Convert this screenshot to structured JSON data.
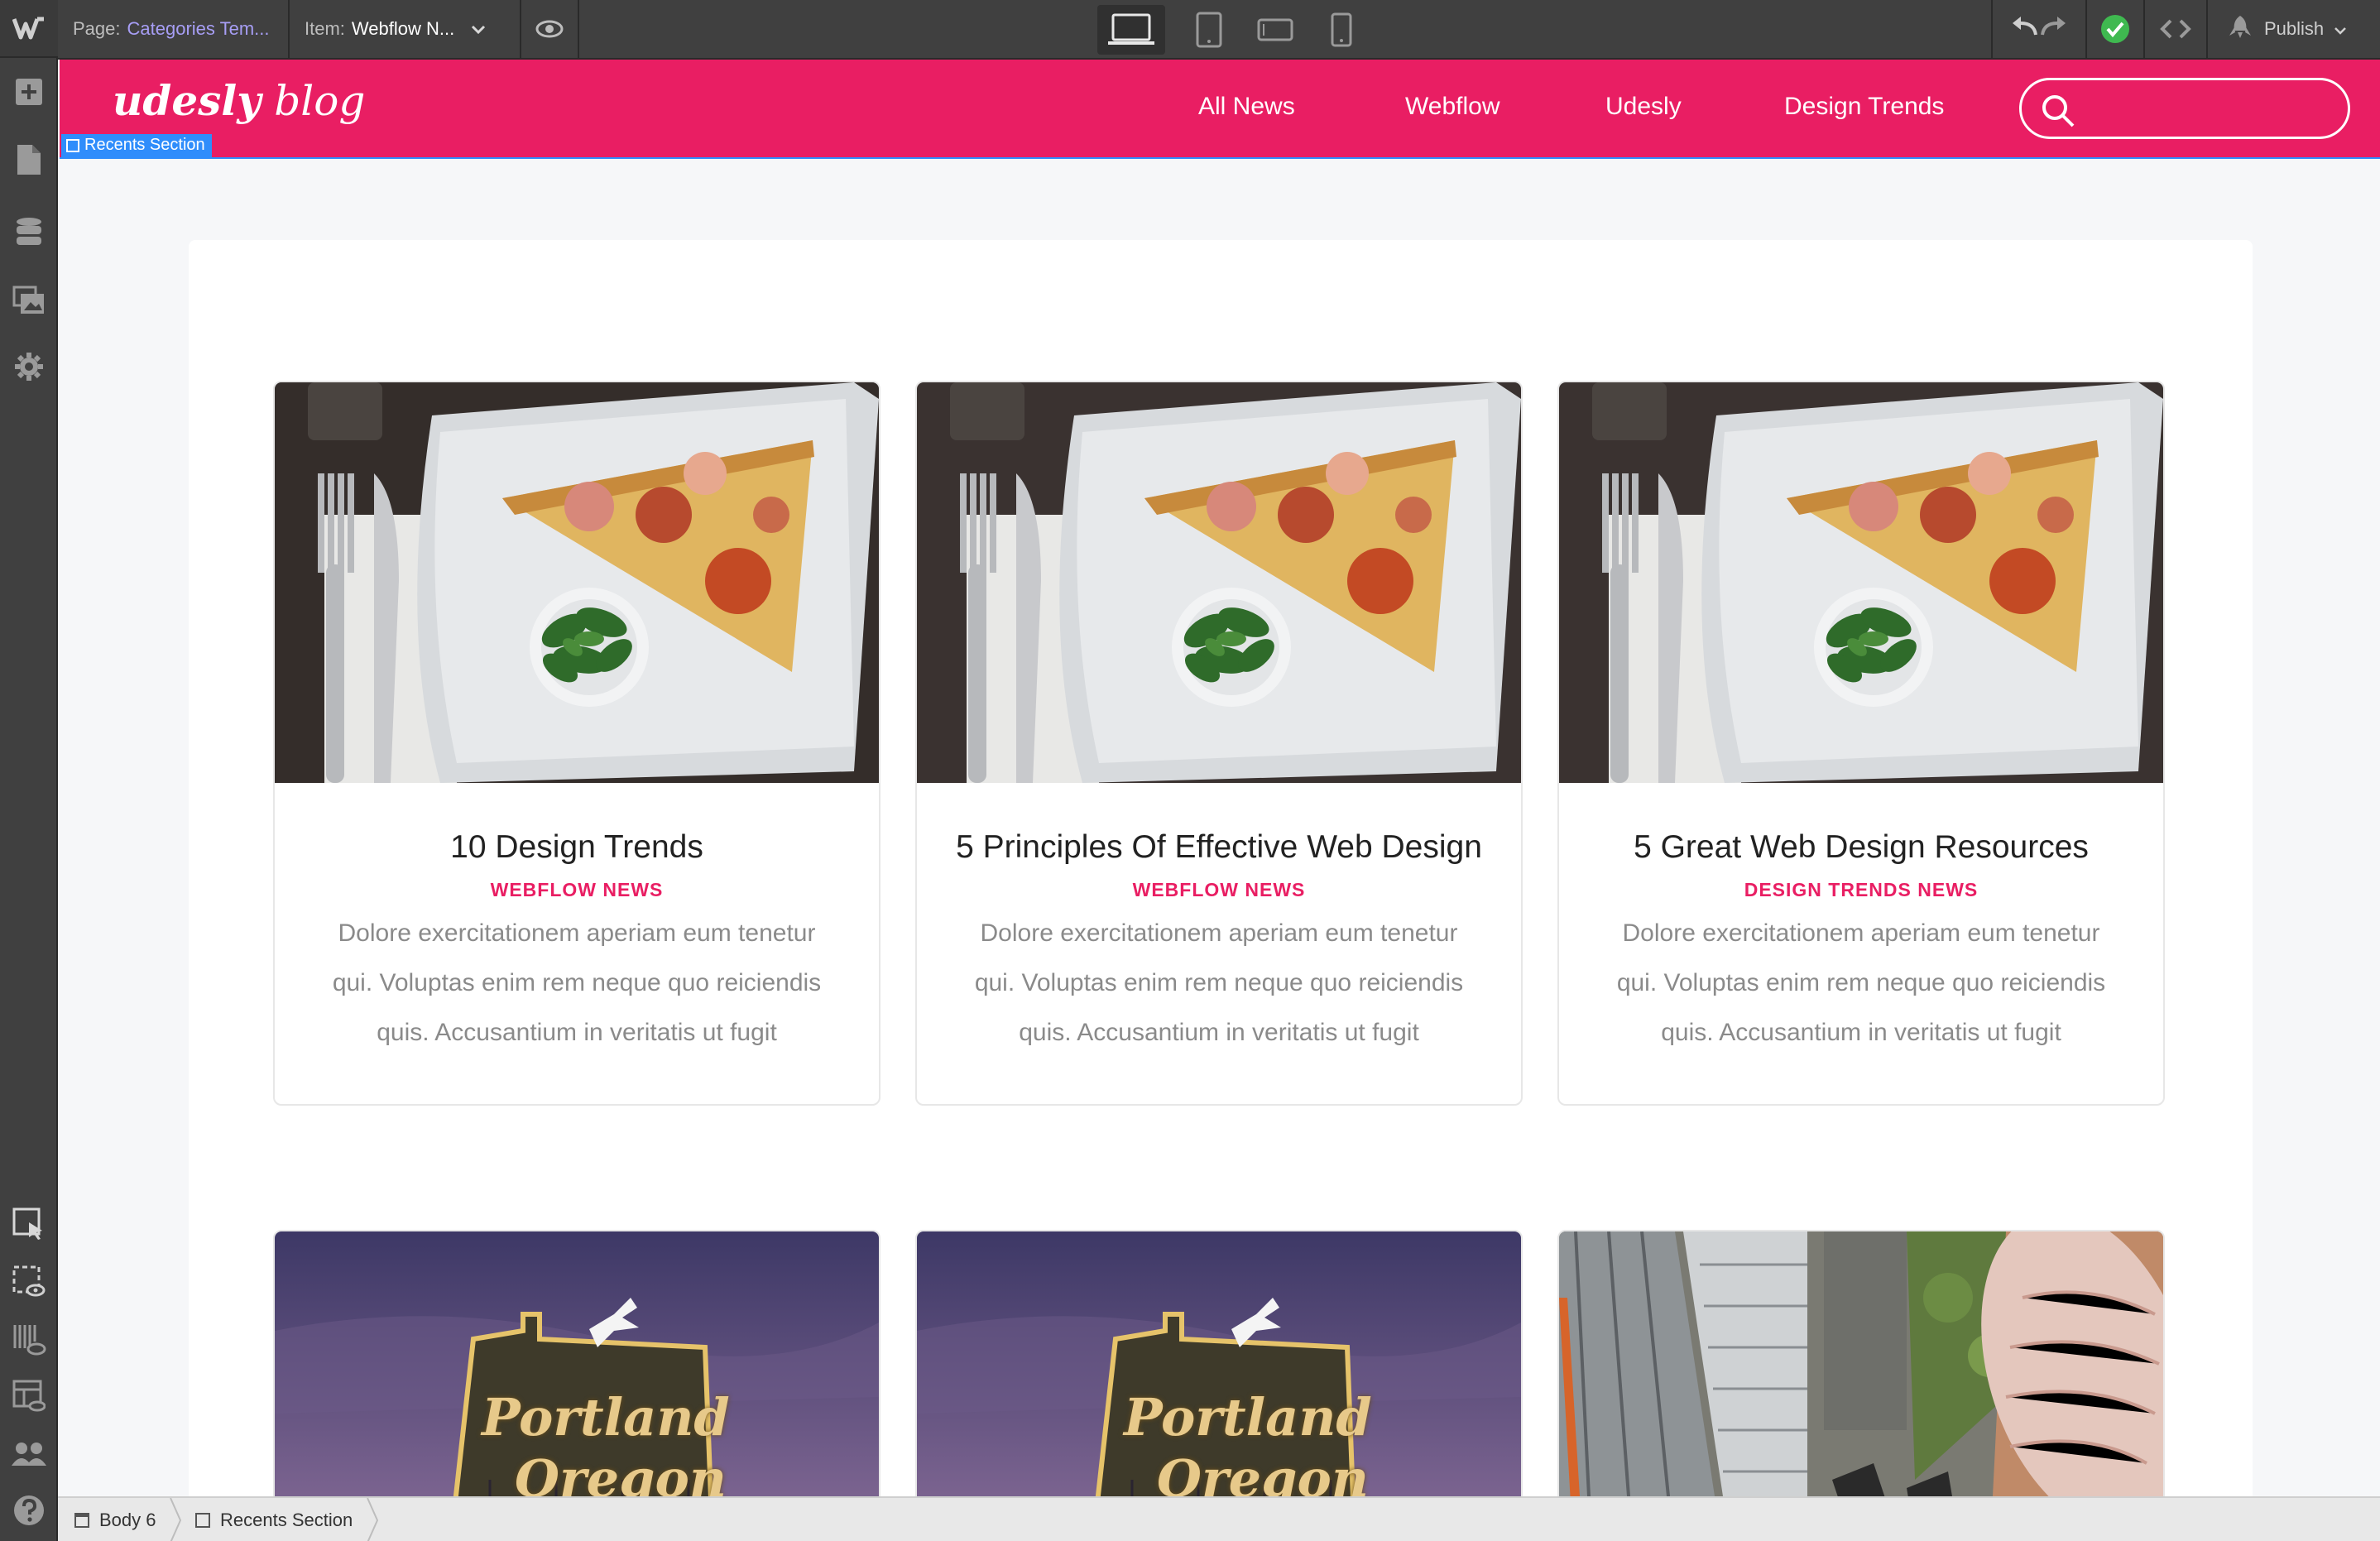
{
  "toolbar": {
    "page_label": "Page:",
    "page_value": "Categories Tem...",
    "item_label": "Item:",
    "item_value": "Webflow N...",
    "publish_label": "Publish"
  },
  "site": {
    "logo_bold": "udesly",
    "logo_light": "blog",
    "nav": [
      "All News",
      "Webflow",
      "Udesly",
      "Design Trends"
    ],
    "selection_tag": "Recents Section"
  },
  "cards": [
    {
      "title": "10 Design Trends",
      "category": "WEBFLOW NEWS",
      "body": "Dolore exercitationem aperiam eum tenetur qui. Voluptas enim rem neque quo reiciendis quis. Accusantium in veritatis ut fugit"
    },
    {
      "title": "5 Principles Of Effective Web Design",
      "category": "WEBFLOW NEWS",
      "body": "Dolore exercitationem aperiam eum tenetur qui. Voluptas enim rem neque quo reiciendis quis. Accusantium in veritatis ut fugit"
    },
    {
      "title": "5 Great Web Design Resources",
      "category": "DESIGN TRENDS NEWS",
      "body": "Dolore exercitationem aperiam eum tenetur qui. Voluptas enim rem neque quo reiciendis quis. Accusantium in veritatis ut fugit"
    }
  ],
  "images": {
    "portland_line1": "Portland",
    "portland_line2": "Oregon"
  },
  "breadcrumbs": [
    "Body 6",
    "Recents Section"
  ],
  "colors": {
    "brand": "#e91e63",
    "selection": "#2f8dfb",
    "editor_bg": "#404040",
    "publish_ok": "#3fb950"
  }
}
